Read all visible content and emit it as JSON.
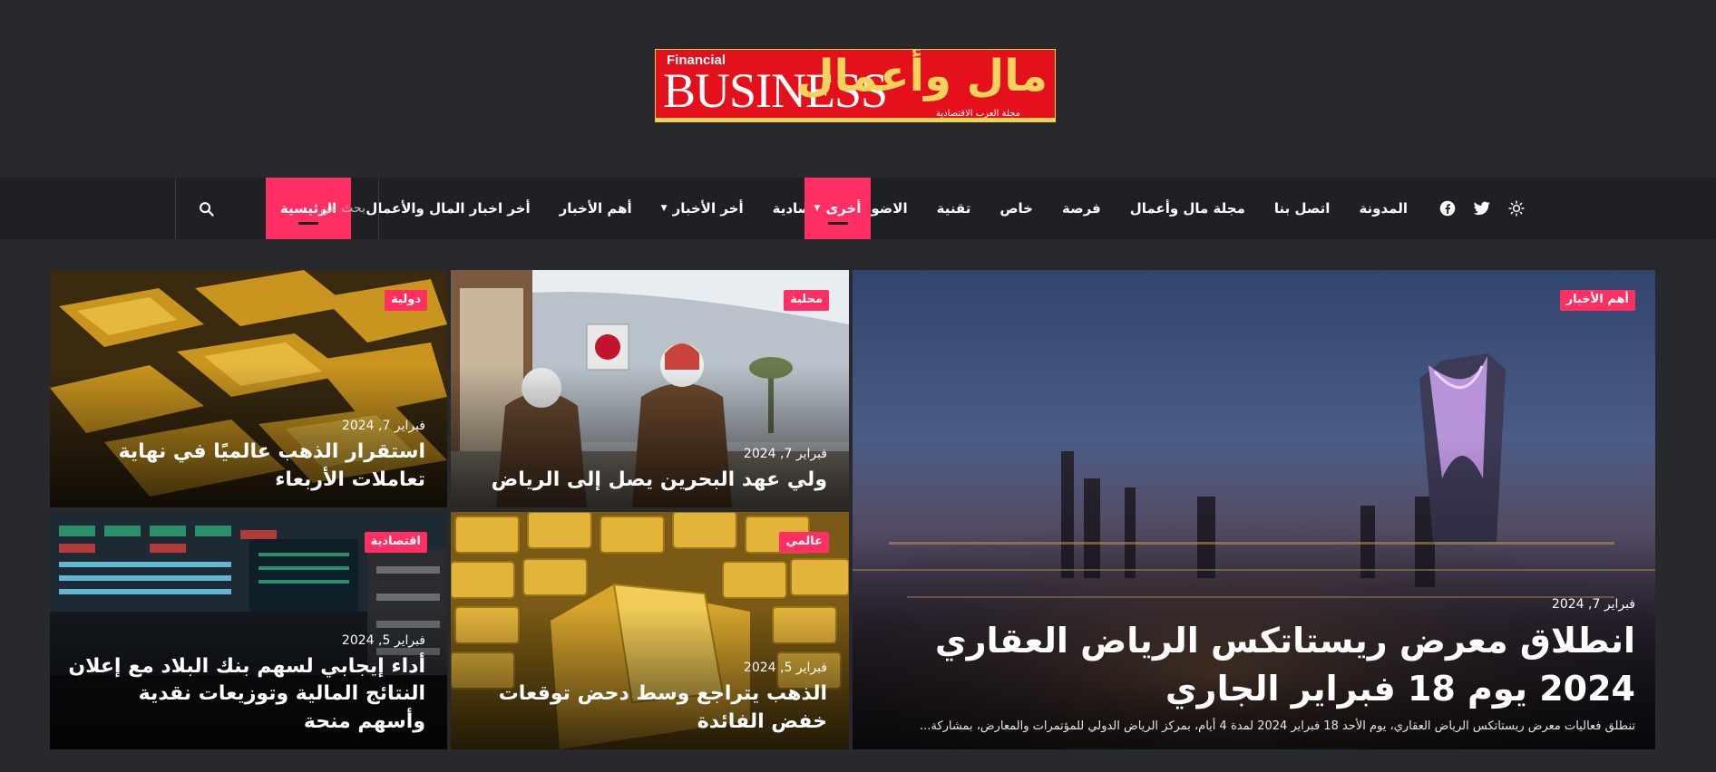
{
  "logo": {
    "financial": "Financial",
    "business": "BUSINESS",
    "arabic": "مال وأعمال",
    "tagline": "مجلة العرب الاقتصادية"
  },
  "nav": {
    "items": [
      {
        "label": "الرئيسية",
        "active": true
      },
      {
        "label": "أخر اخبار المال والأعمال"
      },
      {
        "label": "أهم الأخبار"
      },
      {
        "label": "أخر الأخبار",
        "dropdown": true
      },
      {
        "label": "اقتصادية"
      },
      {
        "label": "الاضواء"
      },
      {
        "label": "تقنية"
      },
      {
        "label": "خاص"
      },
      {
        "label": "فرصة"
      },
      {
        "label": "مجلة مال وأعمال"
      },
      {
        "label": "اتصل بنا"
      },
      {
        "label": "المدونة"
      }
    ],
    "more": {
      "label": "أخرى",
      "active": true,
      "dropdown": true
    },
    "icons": [
      "facebook-icon",
      "twitter-icon",
      "theme-toggle-icon"
    ],
    "search_placeholder": "بحث عن"
  },
  "featured": {
    "badge": "أهم الأخبار",
    "date": "فبراير 7, 2024",
    "title": "انطلاق معرض ريستاتكس الرياض العقاري 2024 يوم 18 فبراير الجاري",
    "excerpt": "تنطلق فعاليات معرض ريستاتكس الرياض العقاري، يوم الأحد 18 فبراير 2024 لمدة 4 أيام، بمركز الرياض الدولي للمؤتمرات والمعارض، بمشاركة..."
  },
  "cards": [
    {
      "badge": "محلية",
      "date": "فبراير 7, 2024",
      "title": "ولي عهد البحرين يصل إلى الرياض"
    },
    {
      "badge": "دولية",
      "date": "فبراير 7, 2024",
      "title": "استقرار الذهب عالميًا في نهاية تعاملات الأربعاء"
    },
    {
      "badge": "عالمي",
      "date": "فبراير 5, 2024",
      "title": "الذهب يتراجع وسط دحض توقعات خفض الفائدة"
    },
    {
      "badge": "اقتصادية",
      "date": "فبراير 5, 2024",
      "title": "أداء إيجابي لسهم بنك البلاد مع إعلان النتائج المالية وتوزيعات نقدية وأسهم منحة"
    }
  ],
  "colors": {
    "accent": "#ff2e63",
    "background": "#27292d",
    "navbar": "#1f2024"
  }
}
